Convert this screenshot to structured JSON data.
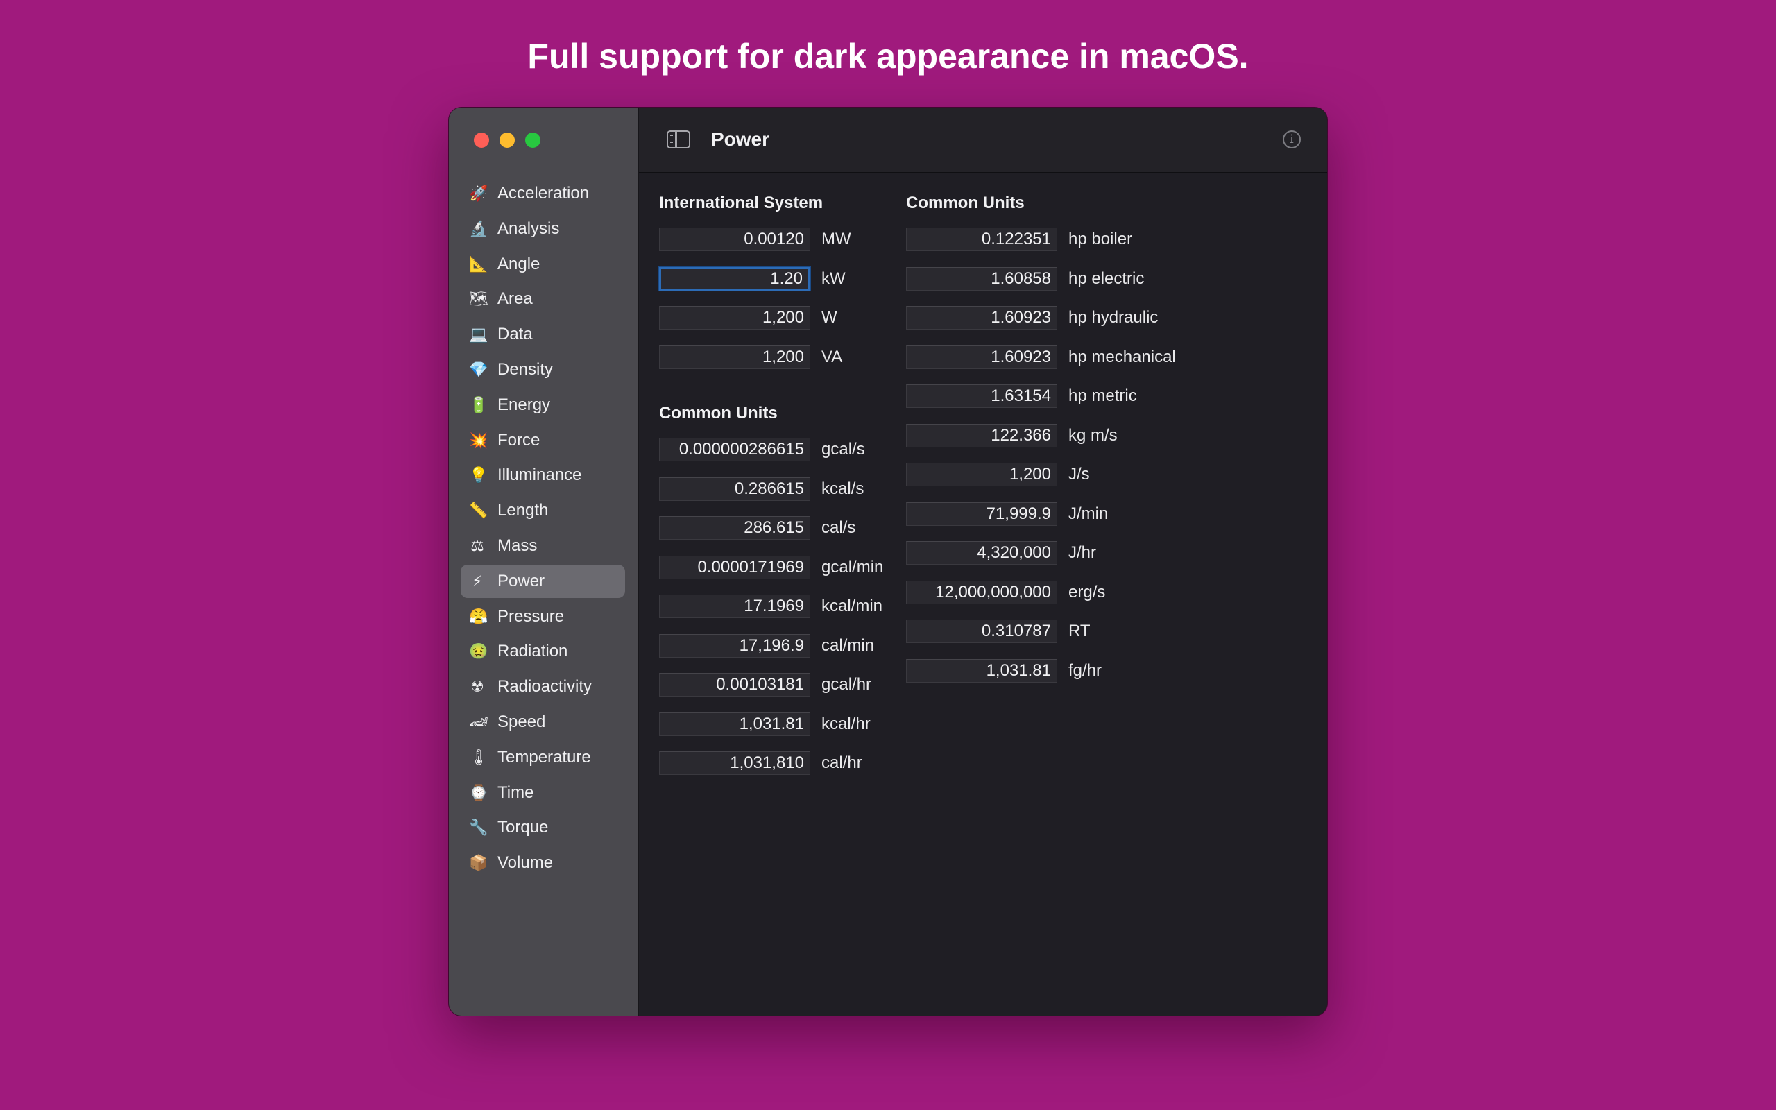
{
  "headline": "Full support for dark appearance in macOS.",
  "window": {
    "title": "Power",
    "sidebar": {
      "items": [
        {
          "icon": "🚀",
          "icon_name": "rocket-icon",
          "label": "Acceleration"
        },
        {
          "icon": "🔬",
          "icon_name": "microscope-icon",
          "label": "Analysis"
        },
        {
          "icon": "📐",
          "icon_name": "triangular-ruler-icon",
          "label": "Angle"
        },
        {
          "icon": "🗺",
          "icon_name": "map-icon",
          "label": "Area"
        },
        {
          "icon": "💻",
          "icon_name": "laptop-icon",
          "label": "Data"
        },
        {
          "icon": "💎",
          "icon_name": "gem-icon",
          "label": "Density"
        },
        {
          "icon": "🔋",
          "icon_name": "battery-icon",
          "label": "Energy"
        },
        {
          "icon": "💥",
          "icon_name": "collision-icon",
          "label": "Force"
        },
        {
          "icon": "💡",
          "icon_name": "light-bulb-icon",
          "label": "Illuminance"
        },
        {
          "icon": "📏",
          "icon_name": "ruler-icon",
          "label": "Length"
        },
        {
          "icon": "⚖",
          "icon_name": "scales-icon",
          "label": "Mass"
        },
        {
          "icon": "⚡",
          "icon_name": "lightning-icon",
          "label": "Power",
          "selected": true
        },
        {
          "icon": "😤",
          "icon_name": "steaming-face-icon",
          "label": "Pressure"
        },
        {
          "icon": "🤢",
          "icon_name": "nauseated-face-icon",
          "label": "Radiation"
        },
        {
          "icon": "☢",
          "icon_name": "radioactive-icon",
          "label": "Radioactivity"
        },
        {
          "icon": "🏎",
          "icon_name": "racing-car-icon",
          "label": "Speed"
        },
        {
          "icon": "🌡",
          "icon_name": "thermometer-icon",
          "label": "Temperature"
        },
        {
          "icon": "⌚",
          "icon_name": "watch-icon",
          "label": "Time"
        },
        {
          "icon": "🔧",
          "icon_name": "wrench-icon",
          "label": "Torque"
        },
        {
          "icon": "📦",
          "icon_name": "package-icon",
          "label": "Volume"
        }
      ]
    },
    "international_system": {
      "title": "International System",
      "rows": [
        {
          "value": "0.00120",
          "unit": "MW"
        },
        {
          "value": "1.20",
          "unit": "kW",
          "focused": true
        },
        {
          "value": "1,200",
          "unit": "W"
        },
        {
          "value": "1,200",
          "unit": "VA"
        }
      ]
    },
    "common_units_left": {
      "title": "Common Units",
      "rows": [
        {
          "value": "0.000000286615",
          "unit": "gcal/s"
        },
        {
          "value": "0.286615",
          "unit": "kcal/s"
        },
        {
          "value": "286.615",
          "unit": "cal/s"
        },
        {
          "value": "0.0000171969",
          "unit": "gcal/min"
        },
        {
          "value": "17.1969",
          "unit": "kcal/min"
        },
        {
          "value": "17,196.9",
          "unit": "cal/min"
        },
        {
          "value": "0.00103181",
          "unit": "gcal/hr"
        },
        {
          "value": "1,031.81",
          "unit": "kcal/hr"
        },
        {
          "value": "1,031,810",
          "unit": "cal/hr"
        }
      ]
    },
    "common_units_right": {
      "title": "Common Units",
      "rows": [
        {
          "value": "0.122351",
          "unit": "hp boiler"
        },
        {
          "value": "1.60858",
          "unit": "hp electric"
        },
        {
          "value": "1.60923",
          "unit": "hp hydraulic"
        },
        {
          "value": "1.60923",
          "unit": "hp mechanical"
        },
        {
          "value": "1.63154",
          "unit": "hp metric"
        },
        {
          "value": "122.366",
          "unit": "kg m/s"
        },
        {
          "value": "1,200",
          "unit": "J/s"
        },
        {
          "value": "71,999.9",
          "unit": "J/min"
        },
        {
          "value": "4,320,000",
          "unit": "J/hr"
        },
        {
          "value": "12,000,000,000",
          "unit": "erg/s"
        },
        {
          "value": "0.310787",
          "unit": "RT"
        },
        {
          "value": "1,031.81",
          "unit": "fg/hr"
        }
      ]
    }
  }
}
